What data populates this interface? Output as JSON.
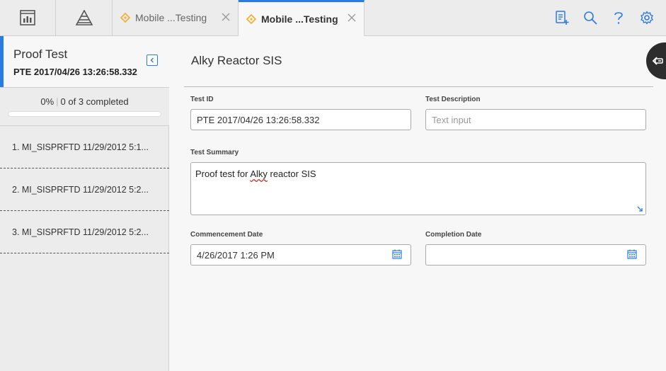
{
  "topbar": {
    "tabs": [
      {
        "label": "Mobile ...Testing",
        "active": false
      },
      {
        "label": "Mobile ...Testing",
        "active": true
      }
    ],
    "icons": [
      "dashboard-icon",
      "hierarchy-icon",
      "new-record-icon",
      "search-icon",
      "help-icon",
      "settings-icon"
    ]
  },
  "left": {
    "title": "Proof Test",
    "subtitle": "PTE 2017/04/26 13:26:58.332",
    "progress": {
      "percent_label": "0%",
      "completed_label": "0 of 3 completed",
      "fraction": 0
    },
    "steps": [
      {
        "label": "1. MI_SISPRFTD 11/29/2012 5:1..."
      },
      {
        "label": "2. MI_SISPRFTD 11/29/2012 5:2..."
      },
      {
        "label": "3. MI_SISPRFTD 11/29/2012 5:2..."
      }
    ]
  },
  "main": {
    "title": "Alky Reactor SIS",
    "fields": {
      "test_id": {
        "label": "Test ID",
        "value": "PTE 2017/04/26 13:26:58.332"
      },
      "test_description": {
        "label": "Test Description",
        "placeholder": "Text input"
      },
      "test_summary": {
        "label": "Test Summary",
        "value_pre": "Proof test for ",
        "value_spell": "Alky",
        "value_post": " reactor SIS"
      },
      "commencement_date": {
        "label": "Commencement Date",
        "value": "4/26/2017 1:26 PM"
      },
      "completion_date": {
        "label": "Completion Date",
        "value": ""
      }
    }
  },
  "colors": {
    "accent": "#2a7be4",
    "tab_icon": "#f2b233",
    "toggle_bg": "#2d2d2d"
  }
}
